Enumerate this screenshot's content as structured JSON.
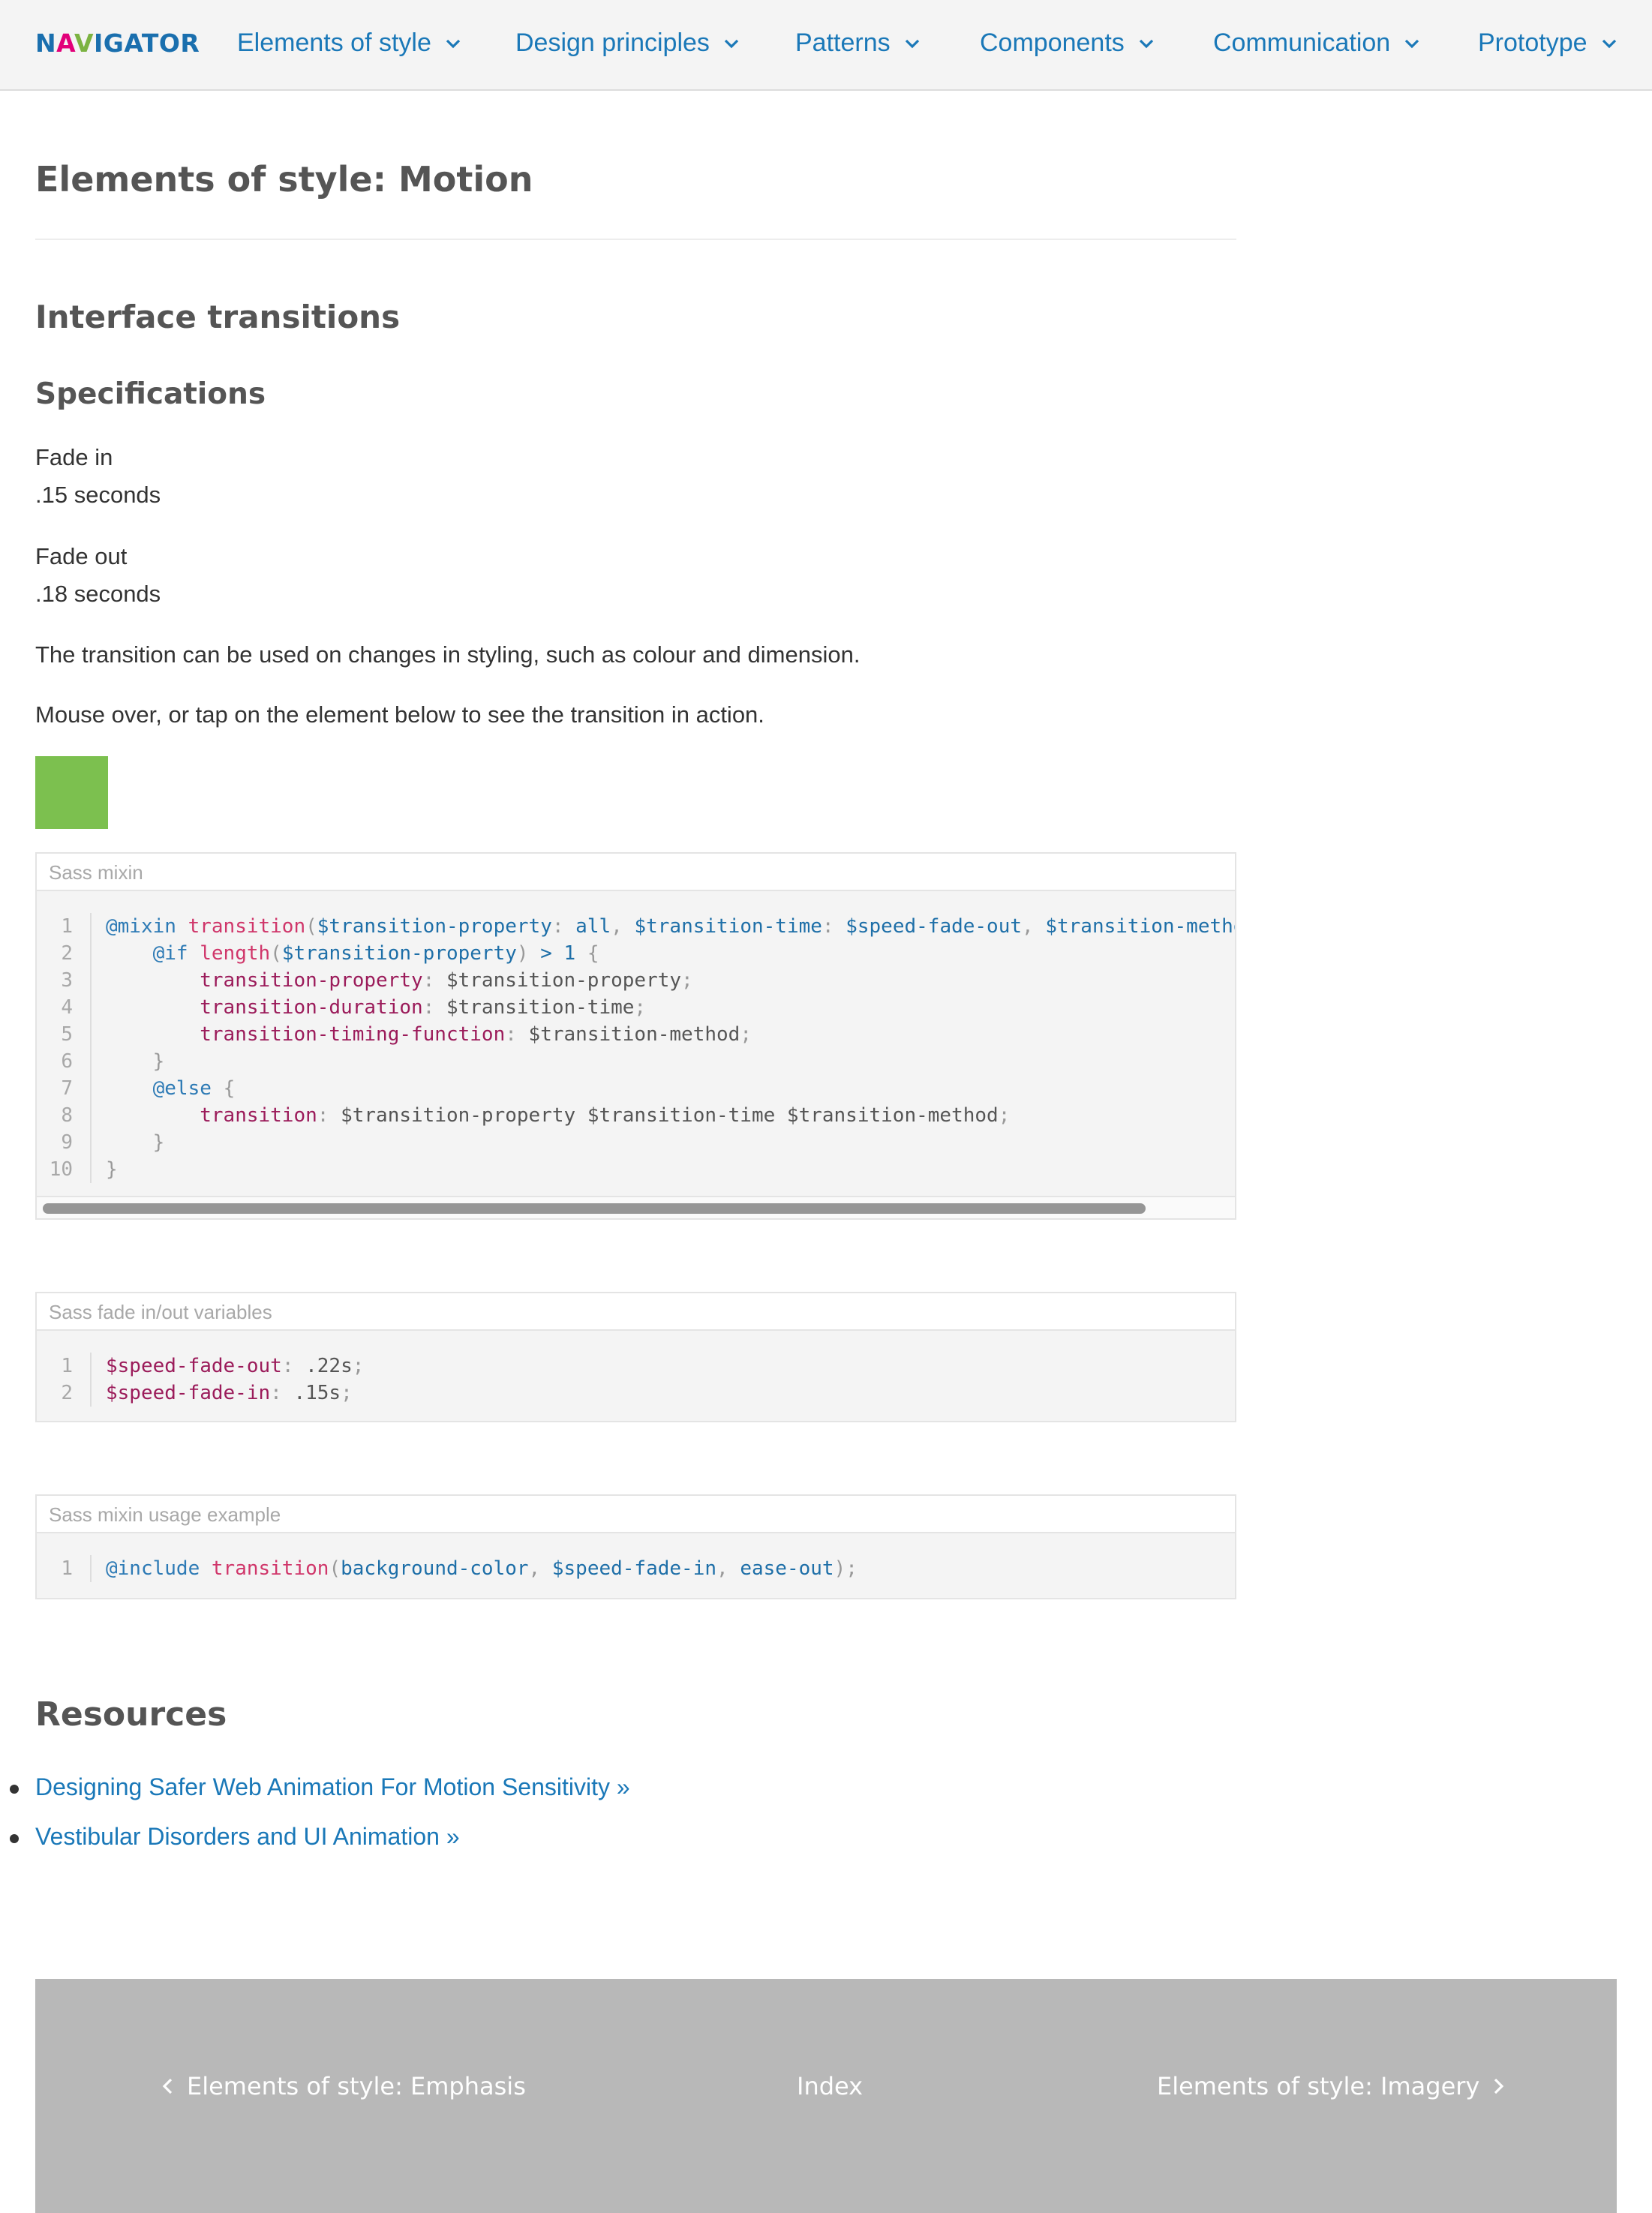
{
  "brand": {
    "logo_prefix": "N",
    "logo_a": "A",
    "logo_v": "V",
    "logo_suffix": "IGATOR"
  },
  "nav": {
    "items": [
      {
        "label": "Elements of style"
      },
      {
        "label": "Design principles"
      },
      {
        "label": "Patterns"
      },
      {
        "label": "Components"
      },
      {
        "label": "Communication"
      },
      {
        "label": "Prototype"
      }
    ]
  },
  "page": {
    "title": "Elements of style: Motion",
    "section_title": "Interface transitions",
    "subsection_title": "Specifications",
    "fade_in_label": "Fade in",
    "fade_in_value": ".15 seconds",
    "fade_out_label": "Fade out",
    "fade_out_value": ".18 seconds",
    "paragraph_1": "The transition can be used on changes in styling, such as colour and dimension.",
    "paragraph_2": "Mouse over, or tap on the element below to see the transition in action."
  },
  "code_blocks": [
    {
      "title": "Sass mixin",
      "line_numbers": [
        "1",
        "2",
        "3",
        "4",
        "5",
        "6",
        "7",
        "8",
        "9",
        "10"
      ]
    },
    {
      "title": "Sass fade in/out variables",
      "line_numbers": [
        "1",
        "2"
      ]
    },
    {
      "title": "Sass mixin usage example",
      "line_numbers": [
        "1"
      ]
    }
  ],
  "resources": {
    "title": "Resources",
    "links": [
      {
        "label": "Designing Safer Web Animation For Motion Sensitivity »"
      },
      {
        "label": "Vestibular Disorders and UI Animation »"
      }
    ]
  },
  "footer": {
    "prev_label": "Elements of style: Emphasis",
    "index_label": "Index",
    "next_label": "Elements of style: Imagery"
  },
  "colors": {
    "link": "#1a78b8",
    "demo_box": "#7cc04f",
    "footer_bg": "#b8b8b8"
  }
}
